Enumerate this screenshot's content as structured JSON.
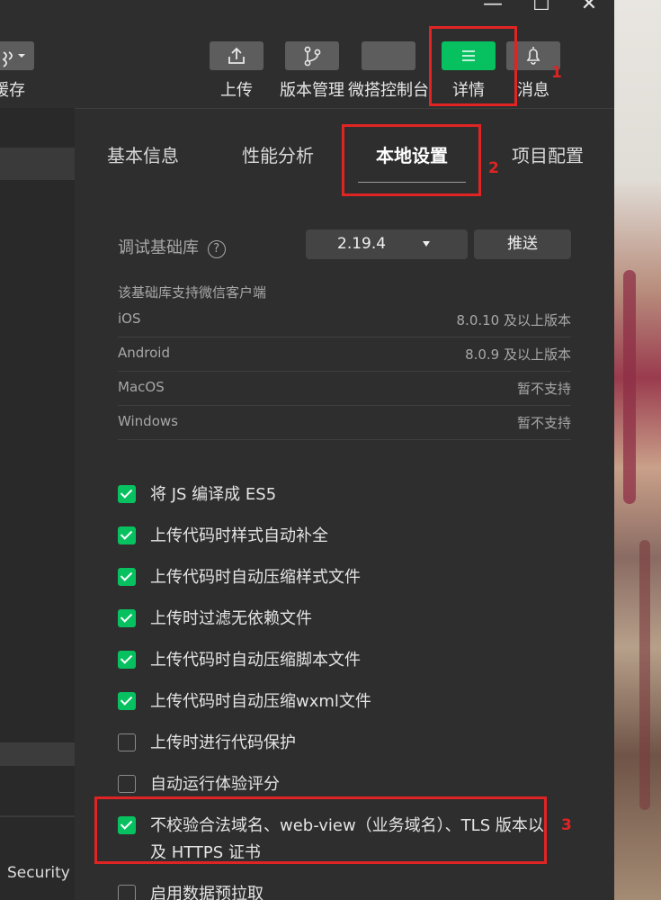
{
  "window": {
    "minimize_glyph": "—",
    "maximize_glyph": "☐",
    "close_glyph": "✕"
  },
  "toolbar": {
    "cache_label": "缓存",
    "buttons": [
      {
        "label": "上传",
        "icon": "upload-icon"
      },
      {
        "label": "版本管理",
        "icon": "branch-icon"
      },
      {
        "label": "微搭控制台",
        "icon": ""
      },
      {
        "label": "详情",
        "icon": "menu-icon",
        "active": true
      },
      {
        "label": "消息",
        "icon": "bell-icon"
      }
    ],
    "active_color": "#07c160"
  },
  "left_panel": {
    "security_label": "Security"
  },
  "details": {
    "tabs": [
      "基本信息",
      "性能分析",
      "本地设置",
      "项目配置"
    ],
    "active_tab": "本地设置",
    "base_lib": {
      "label": "调试基础库",
      "help_glyph": "?",
      "version": "2.19.4",
      "push_label": "推送"
    },
    "support": {
      "title": "该基础库支持微信客户端",
      "rows": [
        {
          "os": "iOS",
          "version": "8.0.10 及以上版本"
        },
        {
          "os": "Android",
          "version": "8.0.9 及以上版本"
        },
        {
          "os": "MacOS",
          "version": "暂不支持"
        },
        {
          "os": "Windows",
          "version": "暂不支持"
        }
      ]
    },
    "options": [
      {
        "label": "将 JS 编译成 ES5",
        "checked": true
      },
      {
        "label": "上传代码时样式自动补全",
        "checked": true
      },
      {
        "label": "上传代码时自动压缩样式文件",
        "checked": true
      },
      {
        "label": "上传时过滤无依赖文件",
        "checked": true
      },
      {
        "label": "上传代码时自动压缩脚本文件",
        "checked": true
      },
      {
        "label": "上传代码时自动压缩wxml文件",
        "checked": true
      },
      {
        "label": "上传时进行代码保护",
        "checked": false
      },
      {
        "label": "自动运行体验评分",
        "checked": false
      },
      {
        "label": "不校验合法域名、web-view（业务域名）、TLS 版本以及 HTTPS 证书",
        "checked": true
      },
      {
        "label": "启用数据预拉取",
        "checked": false
      }
    ]
  },
  "annotations": {
    "marker_1": "1",
    "marker_2": "2",
    "marker_3": "3",
    "color": "#e02424"
  }
}
